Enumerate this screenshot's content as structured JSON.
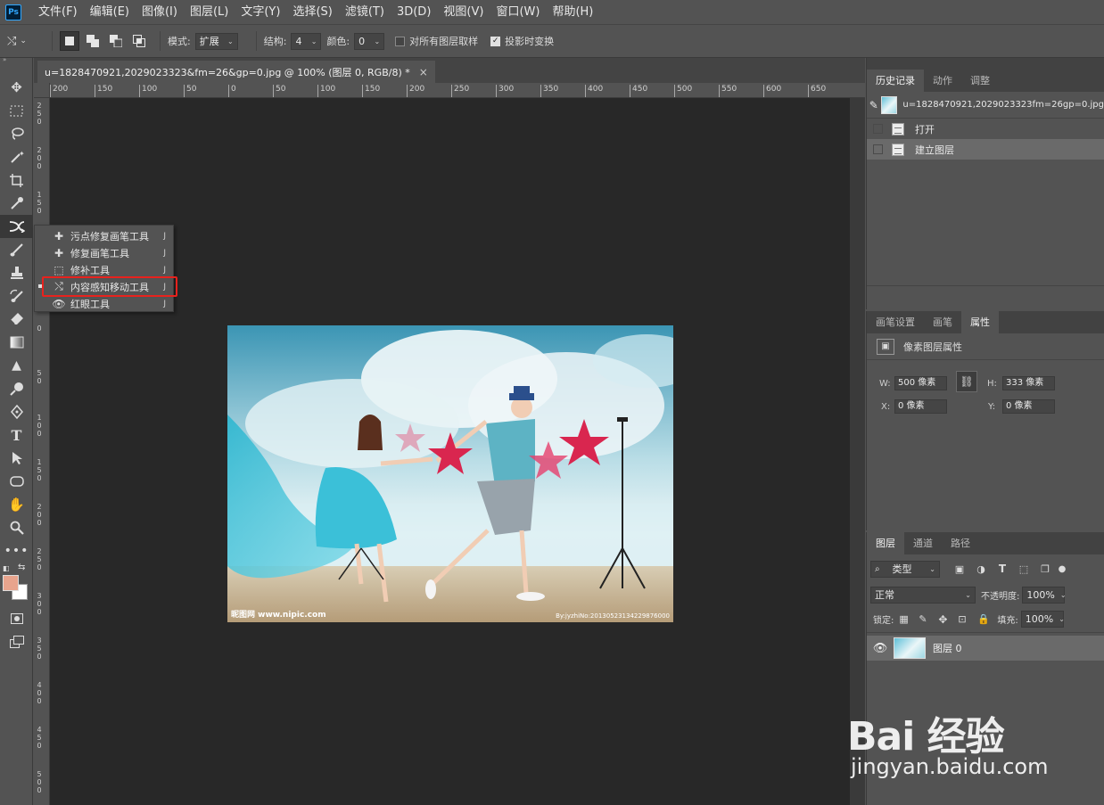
{
  "menubar": {
    "logo": "Ps",
    "items": [
      "文件(F)",
      "编辑(E)",
      "图像(I)",
      "图层(L)",
      "文字(Y)",
      "选择(S)",
      "滤镜(T)",
      "3D(D)",
      "视图(V)",
      "窗口(W)",
      "帮助(H)"
    ]
  },
  "options": {
    "mode_label": "模式:",
    "mode_value": "扩展",
    "structure_label": "结构:",
    "structure_value": "4",
    "color_label": "颜色:",
    "color_value": "0",
    "sample_all_layers": "对所有图层取样",
    "sample_all_layers_checked": false,
    "transform_on_drop": "投影时变换",
    "transform_on_drop_checked": true
  },
  "document": {
    "tab_title": "u=1828470921,2029023323&fm=26&gp=0.jpg @ 100% (图层 0, RGB/8) *",
    "close": "×",
    "ruler_h": [
      "200",
      "150",
      "100",
      "50",
      "0",
      "50",
      "100",
      "150",
      "200",
      "250",
      "300",
      "350",
      "400",
      "450",
      "500",
      "550",
      "600",
      "650"
    ],
    "ruler_v": [
      "250",
      "200",
      "150",
      "100",
      "50",
      "0",
      "50",
      "100",
      "150",
      "200",
      "250",
      "300",
      "350",
      "400",
      "450",
      "500",
      "550"
    ],
    "watermark_left": "昵图网 www.nipic.com",
    "watermark_right": "By:jyzhiNo:20130523134229876000"
  },
  "flyout": {
    "items": [
      {
        "icon": "spot-healing-brush-icon",
        "label": "污点修复画笔工具",
        "key": "J"
      },
      {
        "icon": "healing-brush-icon",
        "label": "修复画笔工具",
        "key": "J"
      },
      {
        "icon": "patch-icon",
        "label": "修补工具",
        "key": "J"
      },
      {
        "icon": "content-aware-move-icon",
        "label": "内容感知移动工具",
        "key": "J"
      },
      {
        "icon": "red-eye-icon",
        "label": "红眼工具",
        "key": "J"
      }
    ]
  },
  "history_panel": {
    "tabs": [
      "历史记录",
      "动作",
      "调整"
    ],
    "snapshot": "u=1828470921,2029023323fm=26gp=0.jpg",
    "steps": [
      "打开",
      "建立图层"
    ]
  },
  "properties_panel": {
    "tabs": [
      "画笔设置",
      "画笔",
      "属性"
    ],
    "title": "像素图层属性",
    "w_label": "W:",
    "w_value": "500 像素",
    "h_label": "H:",
    "h_value": "333 像素",
    "x_label": "X:",
    "x_value": "0 像素",
    "y_label": "Y:",
    "y_value": "0 像素"
  },
  "layers_panel": {
    "tabs": [
      "图层",
      "通道",
      "路径"
    ],
    "filter_kind": "类型",
    "blend_mode": "正常",
    "opacity_label": "不透明度:",
    "opacity_value": "100%",
    "lock_label": "锁定:",
    "fill_label": "填充:",
    "fill_value": "100%",
    "layers": [
      {
        "name": "图层 0",
        "visible": true
      }
    ]
  },
  "watermark": {
    "brand": "Bai 经验",
    "url": "jingyan.baidu.com"
  },
  "colors": {
    "foreground": "#e8a48d",
    "background": "#ffffff",
    "highlight": "#e8221d"
  }
}
